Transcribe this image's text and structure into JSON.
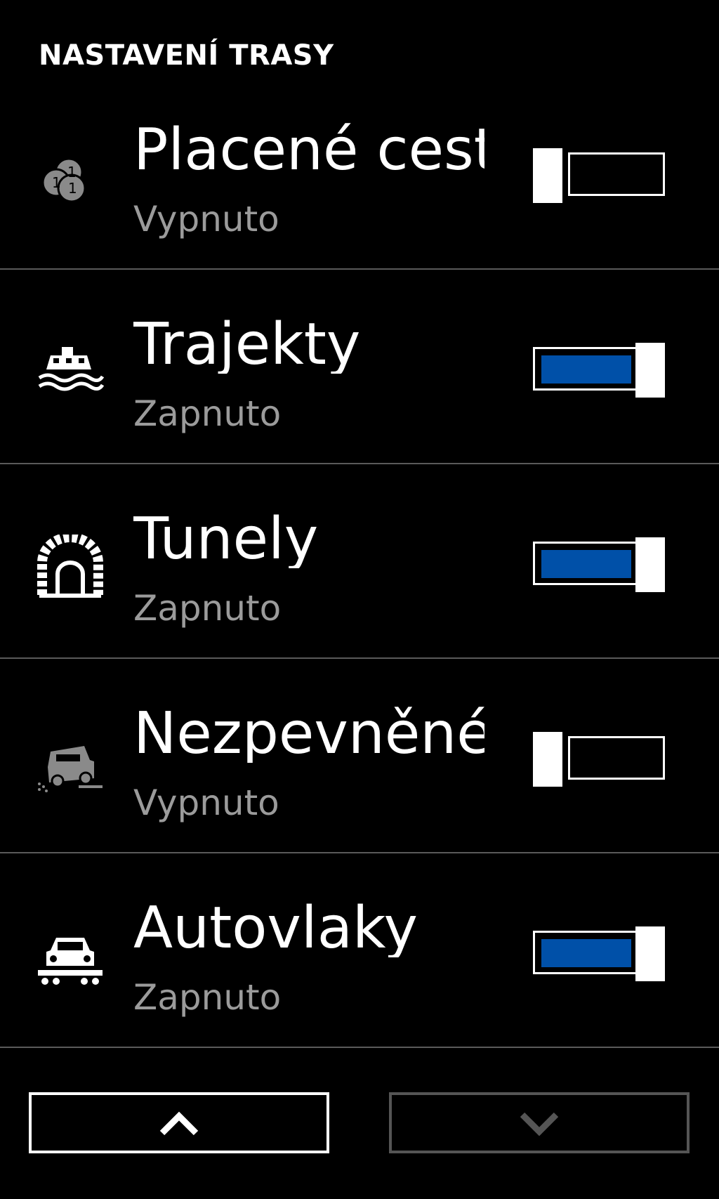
{
  "header": {
    "title": "NASTAVENÍ TRASY"
  },
  "rows": [
    {
      "title": "Placené cesty",
      "status": "Vypnuto",
      "icon": "coins-icon",
      "enabled": false,
      "muted_icon": true
    },
    {
      "title": "Trajekty",
      "status": "Zapnuto",
      "icon": "ferry-icon",
      "enabled": true,
      "muted_icon": false
    },
    {
      "title": "Tunely",
      "status": "Zapnuto",
      "icon": "tunnel-icon",
      "enabled": true,
      "muted_icon": false
    },
    {
      "title": "Nezpevněné",
      "status": "Vypnuto",
      "icon": "unpaved-road-icon",
      "enabled": false,
      "muted_icon": true
    },
    {
      "title": "Autovlaky",
      "status": "Zapnuto",
      "icon": "car-train-icon",
      "enabled": true,
      "muted_icon": false
    }
  ],
  "nav": {
    "up": {
      "icon": "chevron-up-icon",
      "enabled": true
    },
    "down": {
      "icon": "chevron-down-icon",
      "enabled": false
    }
  },
  "colors": {
    "background": "#000000",
    "accent": "#0050a8",
    "status_text": "#9b9b9b",
    "divider": "#5a5a5a",
    "muted_icon": "#8a8a8a"
  }
}
